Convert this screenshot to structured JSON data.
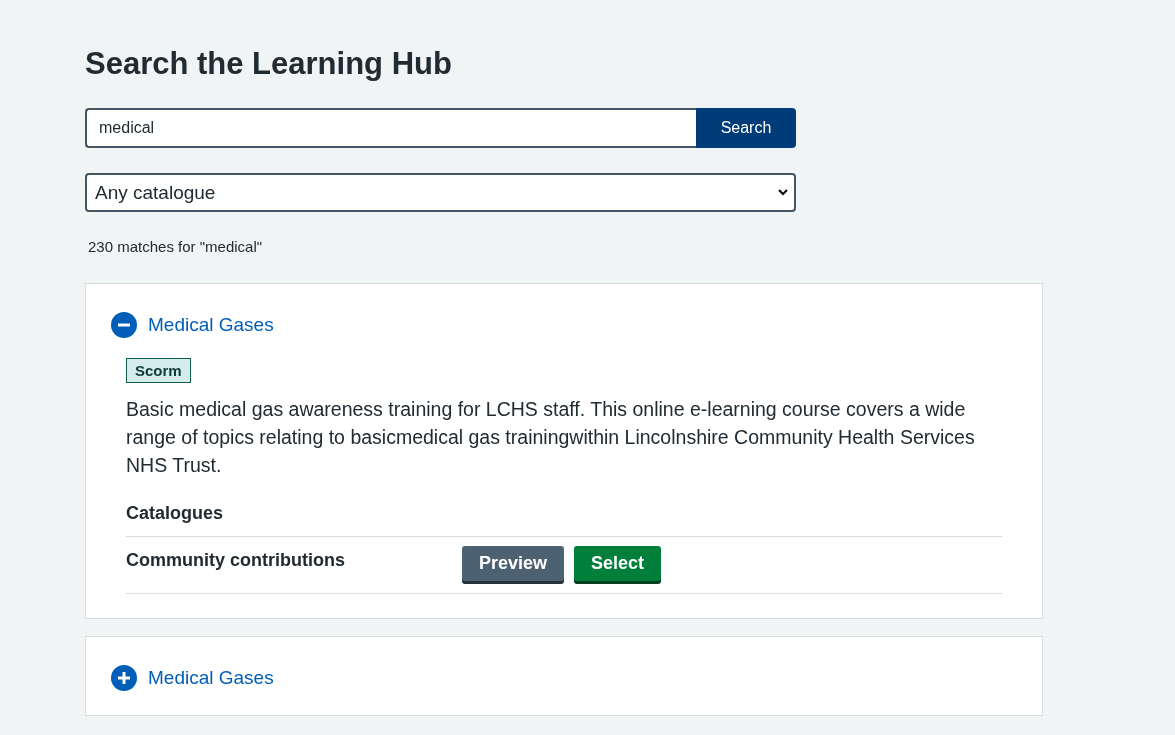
{
  "page_title": "Search the Learning Hub",
  "search": {
    "value": "medical",
    "button": "Search"
  },
  "catalogue_select": {
    "value": "Any catalogue"
  },
  "match_count": "230 matches for \"medical\"",
  "results": [
    {
      "title": "Medical Gases",
      "expanded": true,
      "tag": "Scorm",
      "description": "Basic medical gas awareness training for LCHS staff. This online e-learning course covers a wide range of topics relating to basicmedical gas trainingwithin Lincolnshire Community Health Services NHS Trust.",
      "catalogues_heading": "Catalogues",
      "catalogues": [
        {
          "name": "Community contributions",
          "preview": "Preview",
          "select": "Select"
        }
      ]
    },
    {
      "title": "Medical Gases",
      "expanded": false
    }
  ]
}
